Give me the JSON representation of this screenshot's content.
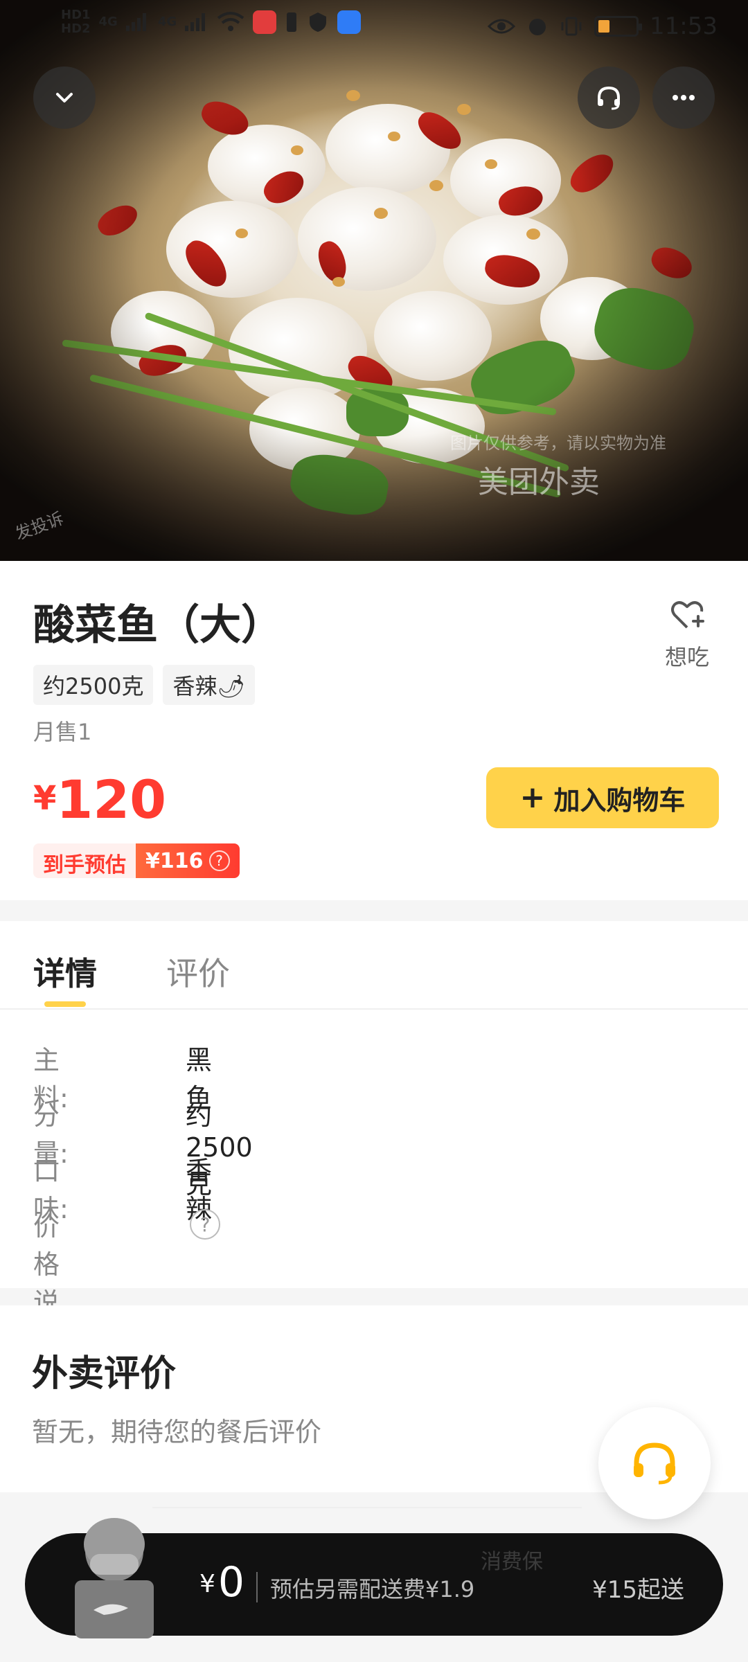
{
  "status_bar": {
    "left_tags": [
      "HD1",
      "HD2"
    ],
    "network_1": "4G",
    "network_2": "4G",
    "time": "11:53"
  },
  "hero": {
    "watermark_main": "美团外卖",
    "watermark_note": "图片仅供参考，请以实物为准",
    "watermark_side": "发投诉"
  },
  "top_buttons": {
    "back_icon": "chevron-down-icon",
    "service_icon": "headset-icon",
    "more_icon": "more-icon"
  },
  "product": {
    "title": "酸菜鱼（大）",
    "tags": [
      "约2500克",
      "香辣🌶"
    ],
    "monthly_sales": "月售1",
    "price_symbol": "¥",
    "price": "120",
    "estimate_label": "到手预估",
    "estimate_value": "¥116",
    "favorite_label": "想吃",
    "add_cart_label": "加入购物车"
  },
  "tabs": {
    "detail": "详情",
    "reviews": "评价"
  },
  "details": {
    "main_label": "主料:",
    "main_value": "黑鱼",
    "portion_label": "分量:",
    "portion_value": "约2500克",
    "taste_label": "口味:",
    "taste_value": "香辣",
    "price_note_label": "价格说明"
  },
  "reviews": {
    "heading": "外卖评价",
    "empty_text": "暂无，期待您的餐后评价"
  },
  "cart_bar": {
    "currency": "¥",
    "total": "0",
    "delivery_fee": "预估另需配送费¥1.9",
    "min_order": "¥15起送",
    "watermark": "消费保"
  },
  "colors": {
    "accent_yellow": "#ffd24a",
    "price_red": "#ff3b30",
    "cart_bar_bg": "#111111"
  }
}
